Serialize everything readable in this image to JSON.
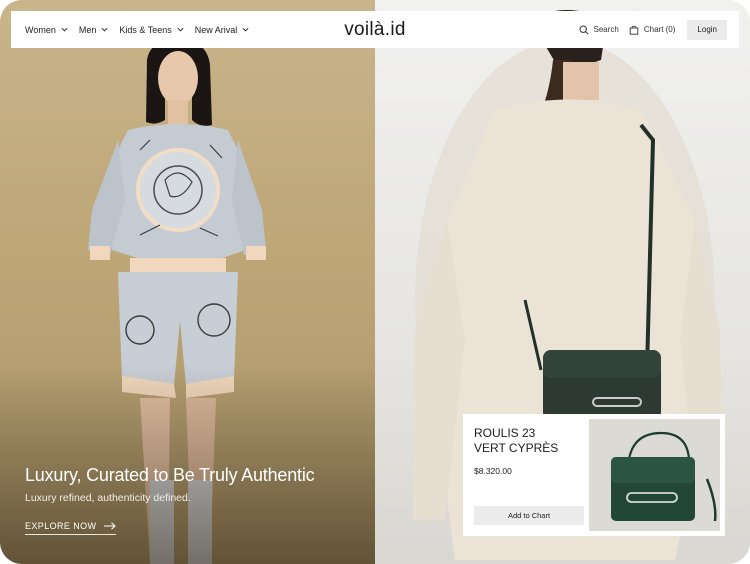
{
  "nav": {
    "items": [
      {
        "label": "Women"
      },
      {
        "label": "Men"
      },
      {
        "label": "Kids & Teens"
      },
      {
        "label": "New Arival"
      }
    ],
    "logo": "voilà.id",
    "search_label": "Search",
    "cart_label": "Chart (0)",
    "login_label": "Login"
  },
  "hero": {
    "title": "Luxury, Curated to Be Truly Authentic",
    "subtitle": "Luxury refined, authenticity defined.",
    "cta_label": "EXPLORE NOW"
  },
  "product": {
    "name_line1": "ROULIS 23",
    "name_line2": "VERT CYPRÈS",
    "price": "$8.320.00",
    "add_label": "Add to Chart",
    "bag_color": "#274a3a"
  },
  "colors": {
    "left_bg": "#c2ac7f",
    "right_bg": "#eceae6",
    "text_dark": "#1a1a1a"
  }
}
